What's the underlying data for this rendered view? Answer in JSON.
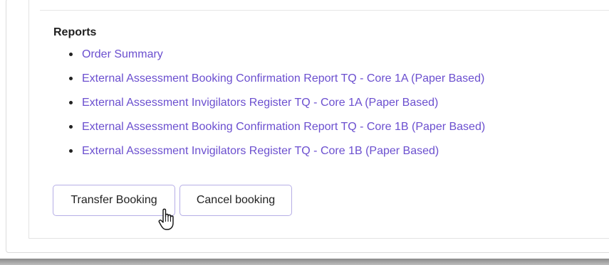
{
  "reports": {
    "title": "Reports",
    "links": [
      "Order Summary",
      "External Assessment Booking Confirmation Report TQ - Core 1A (Paper Based)",
      "External Assessment Invigilators Register TQ - Core 1A (Paper Based)",
      "External Assessment Booking Confirmation Report TQ - Core 1B (Paper Based)",
      "External Assessment Invigilators Register TQ - Core 1B (Paper Based)"
    ]
  },
  "actions": {
    "transfer_label": "Transfer Booking",
    "cancel_label": "Cancel booking"
  },
  "colors": {
    "link": "#6b4fcf",
    "button_border": "#b6aee6"
  },
  "cursor": {
    "icon": "hand-pointer-icon"
  }
}
